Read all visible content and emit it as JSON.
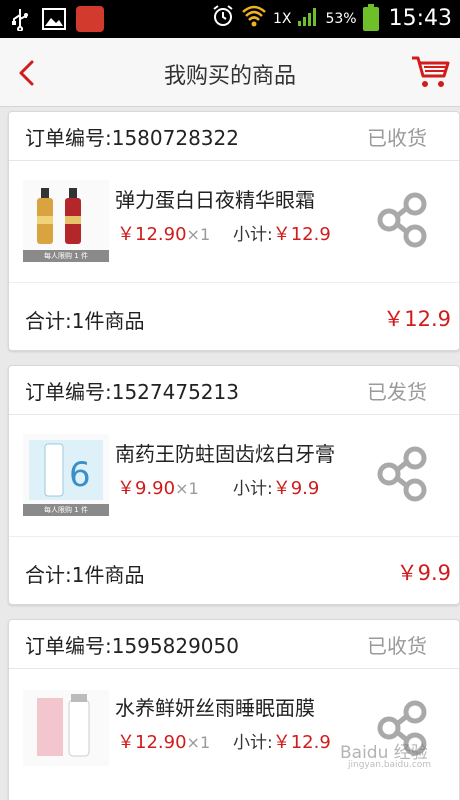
{
  "status_bar": {
    "network_mult": "1X",
    "battery": "53%",
    "time": "15:43"
  },
  "header": {
    "title": "我购买的商品"
  },
  "orders": [
    {
      "order_label": "订单编号:1580728322",
      "status": "已收货",
      "product_name": "弹力蛋白日夜精华眼霜",
      "price": "￥12.90",
      "qty": "×1",
      "subtotal_label": "小计:",
      "subtotal": "￥12.9",
      "summary_label": "合计:1件商品",
      "summary_total": "￥12.9",
      "thumb_caption": "每人限购 1 件"
    },
    {
      "order_label": "订单编号:1527475213",
      "status": "已发货",
      "product_name": "南药王防蛀固齿炫白牙膏",
      "price": "￥9.90",
      "qty": "×1",
      "subtotal_label": "小计:",
      "subtotal": "￥9.9",
      "summary_label": "合计:1件商品",
      "summary_total": "￥9.9",
      "thumb_caption": "每人限购 1 件"
    },
    {
      "order_label": "订单编号:1595829050",
      "status": "已收货",
      "product_name": "水养鲜妍丝雨睡眠面膜",
      "price": "￥12.90",
      "qty": "×1",
      "subtotal_label": "小计:",
      "subtotal": "￥12.9"
    }
  ],
  "watermark": {
    "text": "Baidu 经验",
    "sub": "jingyan.baidu.com"
  },
  "colors": {
    "accent_red": "#d11c1c",
    "status_gray": "#9a9a9a"
  }
}
